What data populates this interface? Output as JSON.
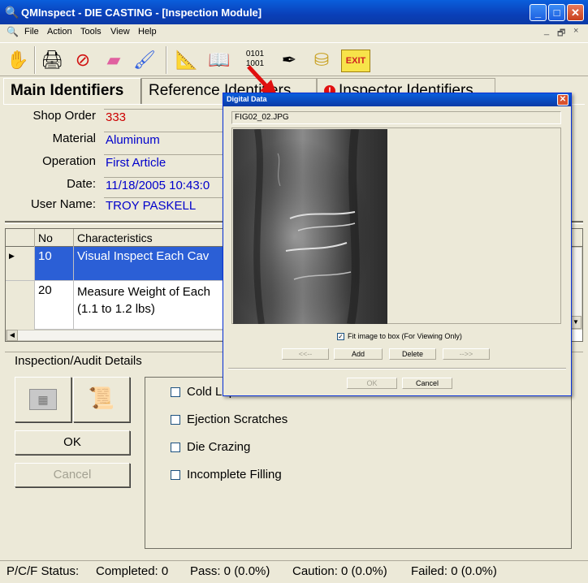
{
  "window": {
    "title": "QMInspect - DIE CASTING - [Inspection Module]",
    "controls": {
      "minimize": "_",
      "maximize": "□",
      "close": "✕"
    },
    "child_controls": [
      "_",
      "🗗",
      "×"
    ]
  },
  "menu": [
    "File",
    "Action",
    "Tools",
    "View",
    "Help"
  ],
  "toolbar": {
    "icons": [
      "hand-icon",
      "printer-icon",
      "no-icon",
      "eraser-icon",
      "brush-icon",
      "compass-icon",
      "book-icon",
      "binary-data-icon",
      "signature-icon",
      "coins-icon",
      "exit-icon"
    ],
    "exit_label": "EXIT"
  },
  "tabs": [
    {
      "label": "Main Identifiers"
    },
    {
      "label": "Reference Identifiers"
    },
    {
      "label": "Inspector Identifiers"
    }
  ],
  "identifiers": [
    {
      "label": "Shop Order",
      "value": "333",
      "color": "#cc0000"
    },
    {
      "label": "Material",
      "value": "Aluminum",
      "color": "#0000cc"
    },
    {
      "label": "Operation",
      "value": "First Article",
      "color": "#0000cc"
    },
    {
      "label": "Date:",
      "value": "11/18/2005 10:43:0",
      "color": "#0000cc"
    },
    {
      "label": "User Name:",
      "value": "TROY PASKELL",
      "color": "#0000cc"
    }
  ],
  "grid": {
    "headers": [
      "No",
      "Characteristics"
    ],
    "rows": [
      {
        "no": "10",
        "characteristic": "Visual Inspect Each Cav",
        "line2": ""
      },
      {
        "no": "20",
        "characteristic": "Measure Weight of Each",
        "line2": "(1.1 to 1.2 lbs)"
      }
    ]
  },
  "details": {
    "title": "Inspection/Audit Details",
    "ok_label": "OK",
    "cancel_label": "Cancel",
    "defects": [
      "Cold Laps",
      "Ejection Scratches",
      "Die Crazing",
      "Incomplete Filling"
    ]
  },
  "status": {
    "prefix": "P/C/F Status:",
    "completed": "Completed: 0",
    "pass": "Pass: 0 (0.0%)",
    "caution": "Caution: 0 (0.0%)",
    "failed": "Failed: 0 (0.0%)"
  },
  "dialog": {
    "title": "Digital Data",
    "filename": "FIG02_02.JPG",
    "fit_label": "Fit image to box (For Viewing Only)",
    "fit_checked": true,
    "prev_label": "<<--",
    "add_label": "Add",
    "delete_label": "Delete",
    "next_label": "-->>",
    "ok_label": "OK",
    "cancel_label": "Cancel"
  },
  "colors": {
    "accent": "#2b5fd6",
    "title_blue": "#0a3fb8",
    "value_blue": "#0000cc",
    "value_red": "#cc0000"
  }
}
